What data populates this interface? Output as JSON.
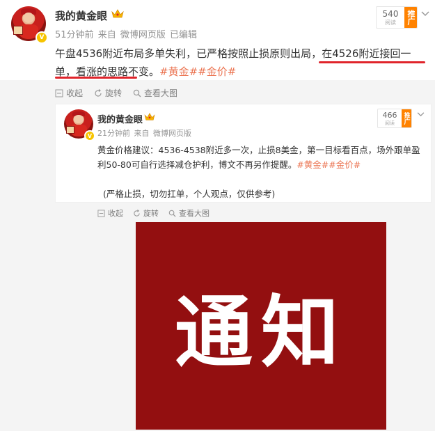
{
  "post": {
    "username": "我的黄金眼",
    "time": "51分钟前",
    "source_prefix": "来自",
    "source": "微博网页版",
    "edited": "已编辑",
    "read_count": "540",
    "read_label": "阅读",
    "promote": "推广",
    "text_part1": "午盘4536附近布局多单失利，已严格按照止损原则出局，",
    "text_highlight": "在4526附近接回一单，看涨的思路不变。",
    "tags": "#黄金##金价#"
  },
  "actions": {
    "collect": "收起",
    "repost": "旋转",
    "view_large": "查看大图"
  },
  "retweet": {
    "username": "我的黄金眼",
    "time": "21分钟前",
    "source_prefix": "来自",
    "source": "微博网页版",
    "read_count": "466",
    "read_label": "阅读",
    "promote": "推广",
    "text": "黄金价格建议：4536-4538附近多一次，止损8美金，第一目标看百点，场外跟单盈利50-80可自行选择减仓护利，博文不再另作提醒。",
    "tags": "#黄金##金价#",
    "note": "(严格止损，切勿扛单，个人观点，仅供参考)"
  },
  "notice": {
    "text": "通知"
  },
  "colors": {
    "tag": "#eb7350",
    "underline": "#e0242b",
    "notice_bg": "#930f10",
    "promote_bg": "#ff8200",
    "verify": "#f7c400"
  }
}
